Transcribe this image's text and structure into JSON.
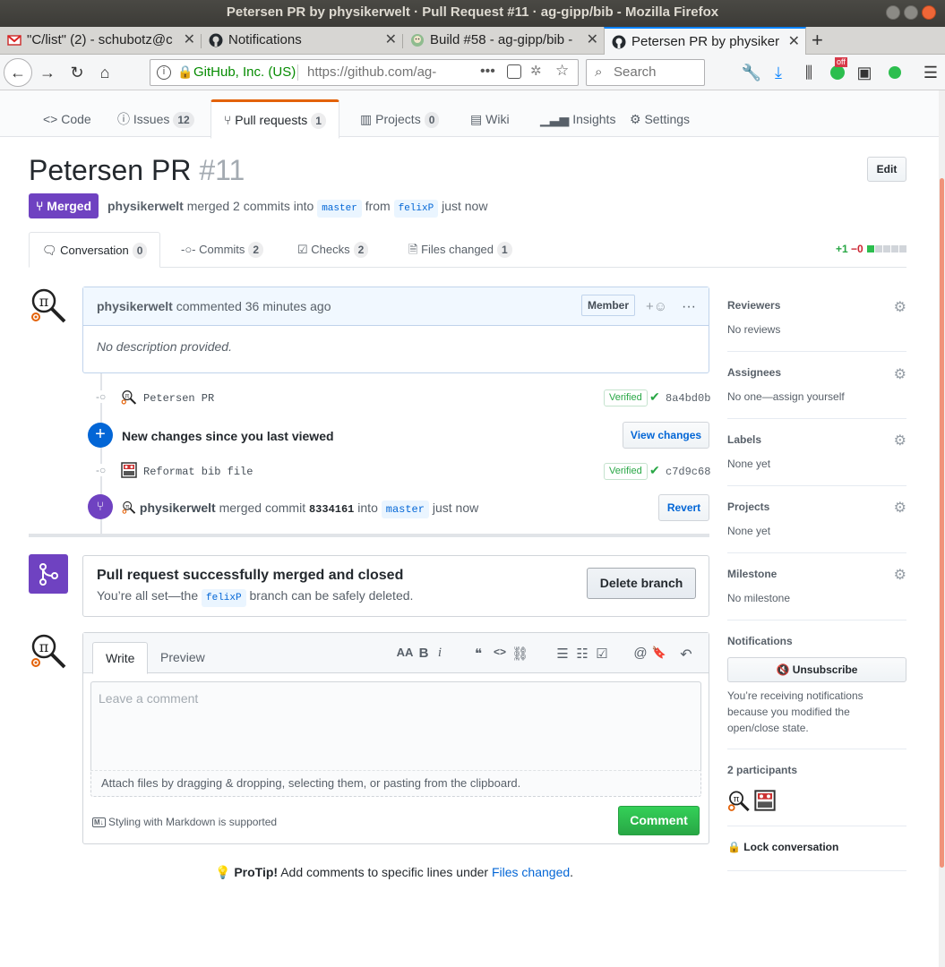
{
  "window": {
    "title": "Petersen PR by physikerwelt · Pull Request #11 · ag-gipp/bib - Mozilla Firefox"
  },
  "browser_tabs": [
    {
      "label": "\"C/list\" (2) - schubotz@c",
      "icon": "gmail-icon"
    },
    {
      "label": "Notifications",
      "icon": "github-icon"
    },
    {
      "label": "Build #58 - ag-gipp/bib -",
      "icon": "jenkins-icon"
    },
    {
      "label": "Petersen PR by physiker",
      "icon": "github-icon",
      "active": true
    }
  ],
  "navbar": {
    "site_identity": "GitHub, Inc. (US)",
    "url": "https://github.com/ag-",
    "search_placeholder": "Search",
    "addon_badge": "off"
  },
  "repo_nav": [
    {
      "label": "Code",
      "icon": "code-icon",
      "count": ""
    },
    {
      "label": "Issues",
      "icon": "issue-icon",
      "count": "12"
    },
    {
      "label": "Pull requests",
      "icon": "pr-icon",
      "count": "1",
      "selected": true
    },
    {
      "label": "Projects",
      "icon": "project-icon",
      "count": "0"
    },
    {
      "label": "Wiki",
      "icon": "book-icon",
      "count": ""
    },
    {
      "label": "Insights",
      "icon": "graph-icon",
      "count": ""
    },
    {
      "label": "Settings",
      "icon": "gear-icon",
      "count": ""
    }
  ],
  "pr": {
    "title": "Petersen PR",
    "number": "#11",
    "edit_label": "Edit",
    "state": "Merged",
    "author": "physikerwelt",
    "merged_text": "merged 2 commits into",
    "base_branch": "master",
    "from_text": "from",
    "head_branch": "felixP",
    "time": "just now"
  },
  "pr_tabs": [
    {
      "label": "Conversation",
      "count": "0",
      "icon": "comment-icon",
      "selected": true
    },
    {
      "label": "Commits",
      "count": "2",
      "icon": "commit-icon"
    },
    {
      "label": "Checks",
      "count": "2",
      "icon": "checklist-icon"
    },
    {
      "label": "Files changed",
      "count": "1",
      "icon": "file-diff-icon"
    }
  ],
  "diffstat": {
    "additions": "+1",
    "deletions": "−0",
    "blocks": [
      "g",
      "n",
      "n",
      "n",
      "n"
    ]
  },
  "comment": {
    "author": "physikerwelt",
    "action": "commented 36 minutes ago",
    "badge": "Member",
    "body": "No description provided."
  },
  "timeline": {
    "commit1": {
      "message": "Petersen PR",
      "verified": "Verified",
      "sha": "8a4bd0b"
    },
    "new_changes": {
      "text": "New changes since you last viewed",
      "button": "View changes"
    },
    "commit2": {
      "message": "Reformat bib file",
      "verified": "Verified",
      "sha": "c7d9c68"
    },
    "merge_event": {
      "author": "physikerwelt",
      "action": "merged commit",
      "sha": "8334161",
      "into": "into",
      "branch": "master",
      "time": "just now",
      "button": "Revert"
    }
  },
  "merge_box": {
    "heading": "Pull request successfully merged and closed",
    "text_before": "You’re all set—the",
    "branch": "felixP",
    "text_after": "branch can be safely deleted.",
    "button": "Delete branch"
  },
  "composer": {
    "tab_write": "Write",
    "tab_preview": "Preview",
    "placeholder": "Leave a comment",
    "attach_text": "Attach files by dragging & dropping, selecting them, or pasting from the clipboard.",
    "markdown_note": "Styling with Markdown is supported",
    "submit": "Comment",
    "toolbar": [
      "AA",
      "B",
      "i",
      "❝",
      "<>",
      "⛓",
      "☰",
      "☷",
      "☑",
      "@",
      "🔖",
      "↶"
    ]
  },
  "protip": {
    "bold": "ProTip!",
    "text": "Add comments to specific lines under",
    "link": "Files changed",
    "end": "."
  },
  "sidebar": {
    "reviewers": {
      "head": "Reviewers",
      "value": "No reviews"
    },
    "assignees": {
      "head": "Assignees",
      "value": "No one—assign yourself"
    },
    "labels": {
      "head": "Labels",
      "value": "None yet"
    },
    "projects": {
      "head": "Projects",
      "value": "None yet"
    },
    "milestone": {
      "head": "Milestone",
      "value": "No milestone"
    },
    "notifications": {
      "head": "Notifications",
      "button": "Unsubscribe",
      "note": "You’re receiving notifications because you modified the open/close state."
    },
    "participants": {
      "head": "2 participants"
    },
    "lock": "Lock conversation"
  }
}
